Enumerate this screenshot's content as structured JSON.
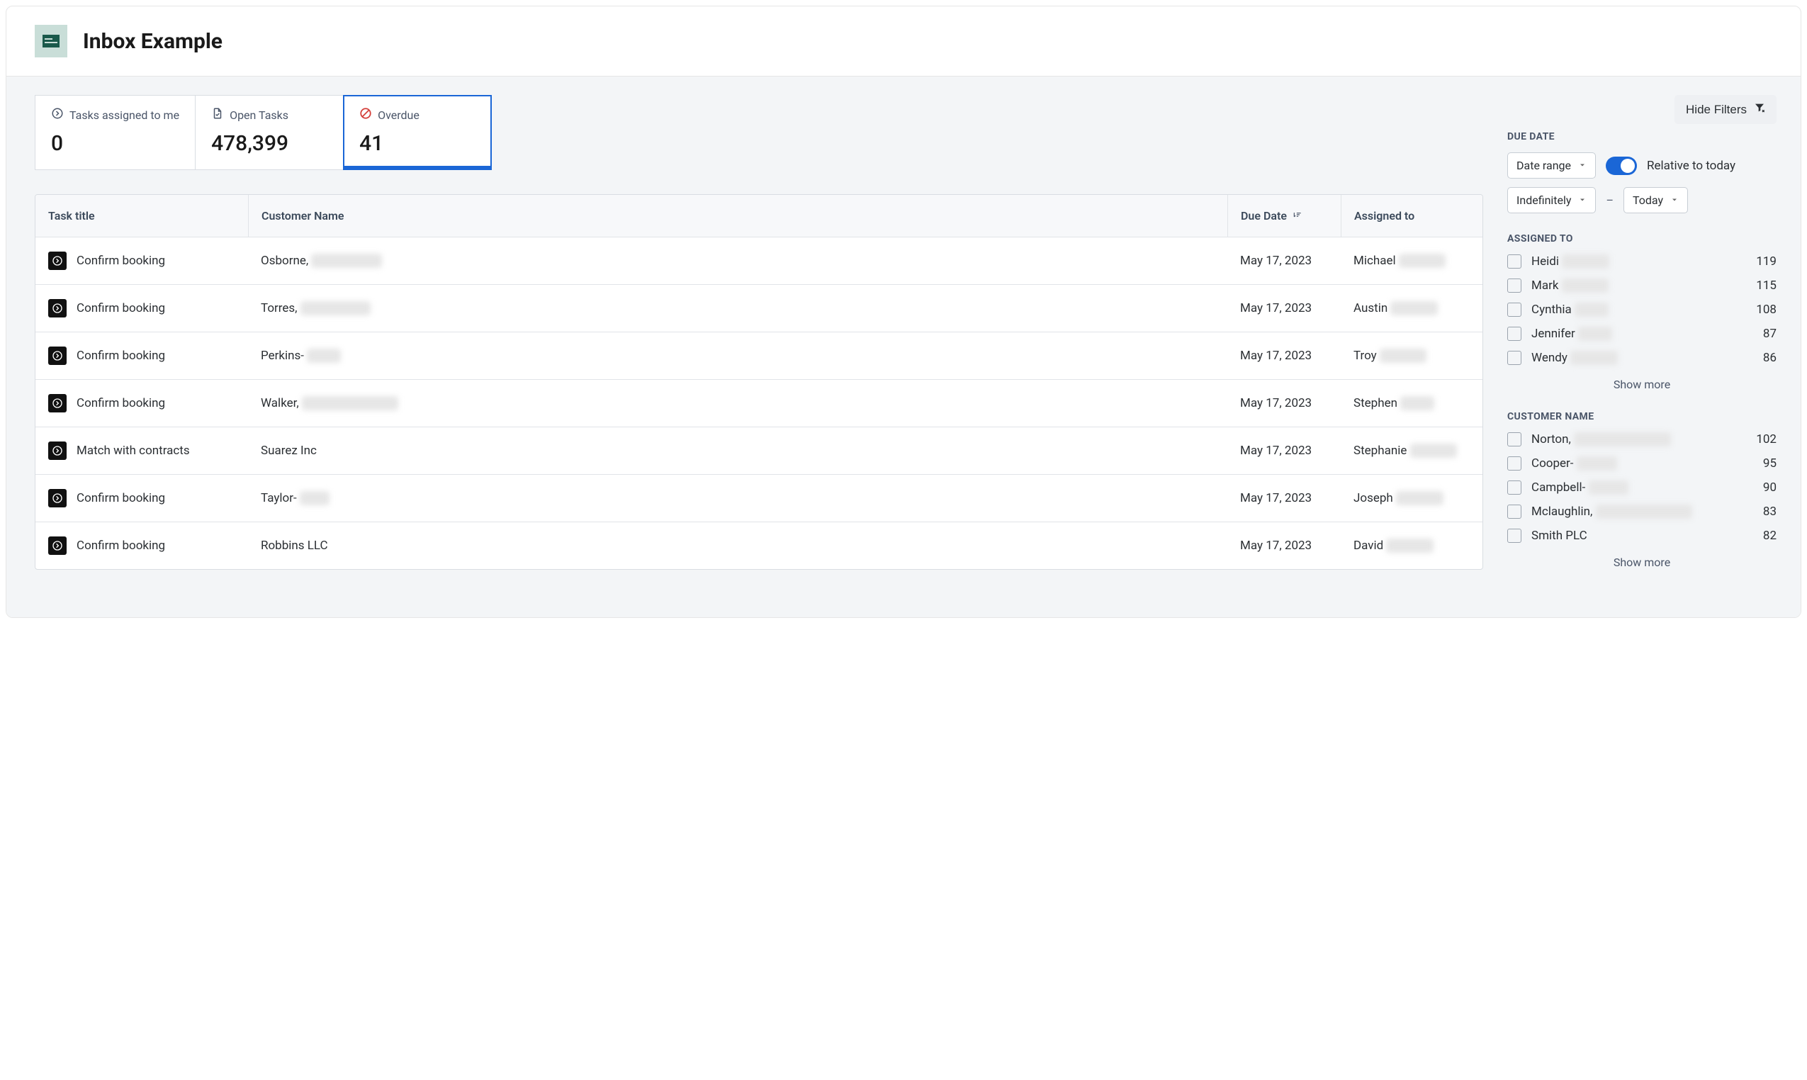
{
  "header": {
    "title": "Inbox Example"
  },
  "stats": [
    {
      "id": "assigned-to-me",
      "label": "Tasks assigned to me",
      "value": "0",
      "icon": "arrow-right-circle",
      "selected": false
    },
    {
      "id": "open-tasks",
      "label": "Open Tasks",
      "value": "478,399",
      "icon": "file-check",
      "selected": false
    },
    {
      "id": "overdue",
      "label": "Overdue",
      "value": "41",
      "icon": "no-entry",
      "selected": true
    }
  ],
  "toolbar": {
    "hide_filters_label": "Hide Filters"
  },
  "table": {
    "columns": {
      "task_title": "Task title",
      "customer_name": "Customer Name",
      "due_date": "Due Date",
      "assigned_to": "Assigned to"
    },
    "rows": [
      {
        "title": "Confirm booking",
        "customer": "Osborne,",
        "customer_rest": "redacted text",
        "due": "May 17, 2023",
        "assigned": "Michael",
        "assigned_rest": "redacted"
      },
      {
        "title": "Confirm booking",
        "customer": "Torres,",
        "customer_rest": "redacted text",
        "due": "May 17, 2023",
        "assigned": "Austin",
        "assigned_rest": "redacted"
      },
      {
        "title": "Confirm booking",
        "customer": "Perkins-",
        "customer_rest": "redact",
        "due": "May 17, 2023",
        "assigned": "Troy",
        "assigned_rest": "redacted"
      },
      {
        "title": "Confirm booking",
        "customer": "Walker,",
        "customer_rest": "redacted text here",
        "due": "May 17, 2023",
        "assigned": "Stephen",
        "assigned_rest": "redact"
      },
      {
        "title": "Match with contracts",
        "customer": "Suarez Inc",
        "customer_rest": "",
        "due": "May 17, 2023",
        "assigned": "Stephanie",
        "assigned_rest": "redacted"
      },
      {
        "title": "Confirm booking",
        "customer": "Taylor-",
        "customer_rest": "redac",
        "due": "May 17, 2023",
        "assigned": "Joseph",
        "assigned_rest": "redacted"
      },
      {
        "title": "Confirm booking",
        "customer": "Robbins LLC",
        "customer_rest": "",
        "due": "May 17, 2023",
        "assigned": "David",
        "assigned_rest": "redacted"
      }
    ]
  },
  "filters": {
    "due_date": {
      "heading": "Due Date",
      "mode_label": "Date range",
      "relative_label": "Relative to today",
      "relative_on": true,
      "from_label": "Indefinitely",
      "to_label": "Today",
      "sep": "–"
    },
    "assigned_to": {
      "heading": "Assigned To",
      "items": [
        {
          "name": "Heidi",
          "rest": "redacted",
          "count": 119
        },
        {
          "name": "Mark",
          "rest": "redacted",
          "count": 115
        },
        {
          "name": "Cynthia",
          "rest": "redact",
          "count": 108
        },
        {
          "name": "Jennifer",
          "rest": "redact",
          "count": 87
        },
        {
          "name": "Wendy",
          "rest": "redacted",
          "count": 86
        }
      ],
      "show_more": "Show more"
    },
    "customer_name": {
      "heading": "Customer Name",
      "items": [
        {
          "name": "Norton,",
          "rest": "redacted text here",
          "count": 102
        },
        {
          "name": "Cooper-",
          "rest": "redacte",
          "count": 95
        },
        {
          "name": "Campbell-",
          "rest": "redacte",
          "count": 90
        },
        {
          "name": "Mclaughlin,",
          "rest": "redacted text here",
          "count": 83
        },
        {
          "name": "Smith PLC",
          "rest": "",
          "count": 82
        }
      ],
      "show_more": "Show more"
    }
  }
}
